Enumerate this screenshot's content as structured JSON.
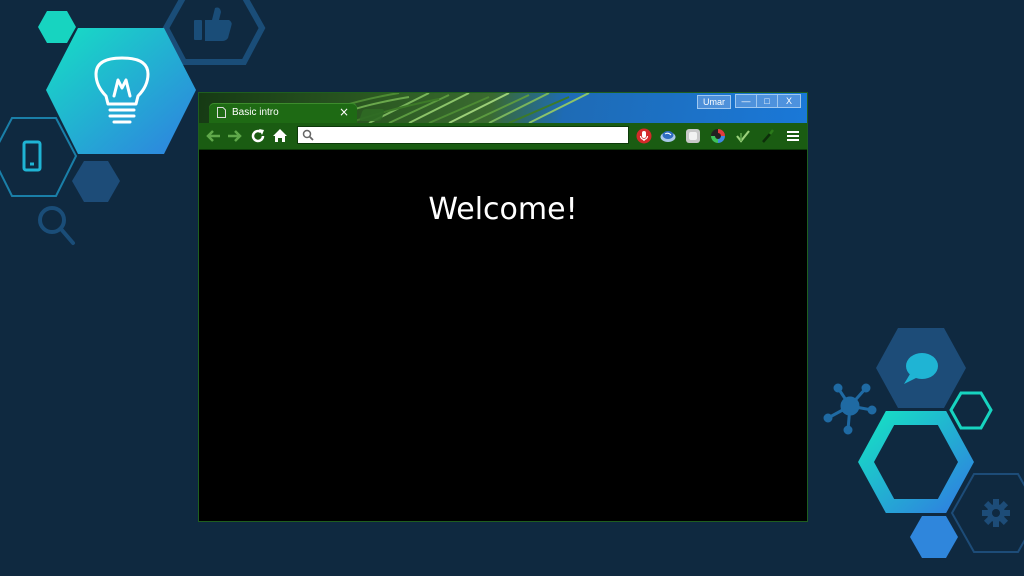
{
  "theme": {
    "background": "#0f2940",
    "toolbar_green": "#1a5c12",
    "accent_teal": "#19d2c8",
    "accent_blue": "#2f7fe0"
  },
  "decorations": {
    "icons": [
      "lightbulb-icon",
      "thumbs-up-icon",
      "smartphone-icon",
      "magnifier-icon",
      "chat-bubble-icon",
      "network-icon",
      "gear-icon"
    ]
  },
  "browser": {
    "tab": {
      "label": "Basic intro",
      "close": "×"
    },
    "window": {
      "user": "Umar",
      "minimize": "—",
      "maximize": "□",
      "close": "X"
    },
    "omnibox": {
      "value": "",
      "placeholder": ""
    },
    "extensions": [
      "voice-search-icon",
      "globe-icon",
      "square-extension-icon",
      "color-picker-icon",
      "check-extension-icon",
      "eyedropper-icon"
    ]
  },
  "page": {
    "heading": "Welcome!"
  }
}
